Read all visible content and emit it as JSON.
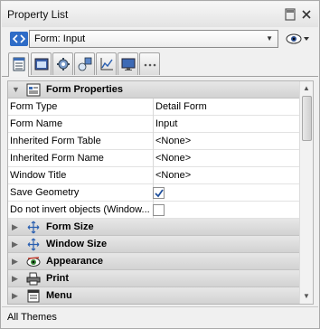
{
  "window": {
    "title": "Property List"
  },
  "selector": {
    "value": "Form: Input"
  },
  "tabs": [
    {
      "icon": "list-icon"
    },
    {
      "icon": "form-icon"
    },
    {
      "icon": "gear-icon"
    },
    {
      "icon": "shapes-icon"
    },
    {
      "icon": "chart-icon"
    },
    {
      "icon": "monitor-icon"
    },
    {
      "icon": "more-icon"
    }
  ],
  "groups": {
    "form_properties": {
      "label": "Form Properties",
      "expanded": true
    },
    "form_size": {
      "label": "Form Size"
    },
    "window_size": {
      "label": "Window Size"
    },
    "appearance": {
      "label": "Appearance"
    },
    "print": {
      "label": "Print"
    },
    "menu": {
      "label": "Menu"
    }
  },
  "properties": [
    {
      "name": "Form Type",
      "value": "Detail Form"
    },
    {
      "name": "Form Name",
      "value": "Input"
    },
    {
      "name": "Inherited Form Table",
      "value": "<None>"
    },
    {
      "name": "Inherited Form Name",
      "value": "<None>"
    },
    {
      "name": "Window Title",
      "value": "<None>"
    },
    {
      "name": "Save Geometry",
      "checked": true
    },
    {
      "name": "Do not invert objects (Window...",
      "checked": false
    }
  ],
  "status": {
    "text": "All Themes"
  },
  "colors": {
    "accent": "#2e6cc7",
    "group_bg": "#dcdcdc"
  }
}
